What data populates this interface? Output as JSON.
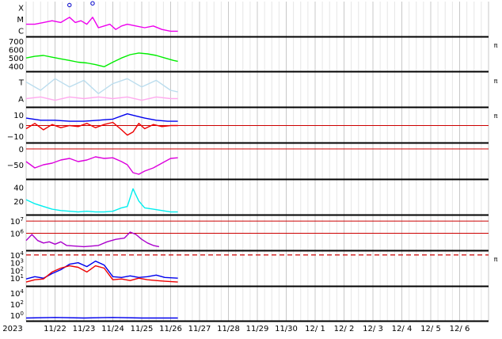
{
  "chart_data": {
    "type": "multi-panel-timeseries",
    "x_tick_labels": [
      "2023",
      "11/22",
      "11/23",
      "11/24",
      "11/25",
      "11/26",
      "11/27",
      "11/28",
      "11/29",
      "11/30",
      "12/ 1",
      "12/ 2",
      "12/ 3",
      "12/ 4",
      "12/ 5",
      "12/ 6"
    ],
    "x_start_day": 21.5,
    "x_end_day": 37.5,
    "data_end_day": 26.75,
    "panels": [
      {
        "id": "xray",
        "y_tick_labels": [
          "X",
          "M",
          "C"
        ],
        "right_label": "",
        "series": [
          {
            "color": "#ee00ee",
            "x": [
              21.5,
              21.8,
              22.1,
              22.4,
              22.7,
              23.0,
              23.2,
              23.4,
              23.6,
              23.8,
              24.0,
              24.2,
              24.4,
              24.6,
              24.8,
              25.0,
              25.3,
              25.6,
              25.9,
              26.2,
              26.5,
              26.75
            ],
            "y": [
              0.35,
              0.35,
              0.4,
              0.45,
              0.4,
              0.55,
              0.4,
              0.45,
              0.35,
              0.55,
              0.25,
              0.3,
              0.35,
              0.2,
              0.3,
              0.35,
              0.3,
              0.25,
              0.3,
              0.2,
              0.15,
              0.15
            ]
          }
        ],
        "markers": [
          {
            "x": 23.0,
            "y": 0.9
          },
          {
            "x": 23.8,
            "y": 0.95
          }
        ]
      },
      {
        "id": "solar-wind-speed",
        "y_tick_labels": [
          "700",
          "600",
          "500",
          "400"
        ],
        "y_tick_values": [
          700,
          600,
          500,
          400
        ],
        "ylim": [
          340,
          740
        ],
        "right_label": "π",
        "series": [
          {
            "color": "#00ee00",
            "x": [
              21.5,
              21.8,
              22.1,
              22.4,
              22.7,
              23.0,
              23.3,
              23.6,
              23.9,
              24.2,
              24.5,
              24.8,
              25.1,
              25.4,
              25.7,
              26.0,
              26.3,
              26.6,
              26.75
            ],
            "y": [
              500,
              520,
              530,
              510,
              490,
              470,
              450,
              440,
              420,
              395,
              450,
              500,
              540,
              560,
              550,
              530,
              500,
              470,
              460
            ]
          }
        ]
      },
      {
        "id": "imf-direction",
        "y_tick_labels": [
          "T",
          "A"
        ],
        "right_label": "π",
        "series": [
          {
            "color": "#bbddee",
            "x": [
              21.5,
              22.0,
              22.5,
              23.0,
              23.5,
              24.0,
              24.5,
              25.0,
              25.5,
              26.0,
              26.5,
              26.75
            ],
            "y": [
              0.75,
              0.5,
              0.85,
              0.6,
              0.8,
              0.4,
              0.7,
              0.85,
              0.6,
              0.8,
              0.5,
              0.45
            ]
          },
          {
            "color": "#ffaaee",
            "x": [
              21.5,
              22.0,
              22.5,
              23.0,
              23.5,
              24.0,
              24.5,
              25.0,
              25.5,
              26.0,
              26.5,
              26.75
            ],
            "y": [
              0.25,
              0.3,
              0.2,
              0.3,
              0.25,
              0.3,
              0.25,
              0.3,
              0.2,
              0.3,
              0.25,
              0.25
            ]
          }
        ]
      },
      {
        "id": "imf-magnitude",
        "y_tick_labels": [
          "10",
          "0",
          "−10"
        ],
        "y_tick_values": [
          10,
          0,
          -10
        ],
        "ylim": [
          -16,
          16
        ],
        "reference_lines": [
          0
        ],
        "right_label": "π",
        "series": [
          {
            "color": "#0000ee",
            "x": [
              21.5,
              22.0,
              22.5,
              23.0,
              23.5,
              24.0,
              24.5,
              25.0,
              25.3,
              25.6,
              26.0,
              26.4,
              26.75
            ],
            "y": [
              7,
              5,
              5,
              4,
              4,
              5,
              6,
              11,
              9,
              7,
              5,
              4,
              4
            ]
          },
          {
            "color": "#ee0000",
            "x": [
              21.5,
              21.8,
              22.1,
              22.4,
              22.7,
              23.0,
              23.3,
              23.6,
              23.9,
              24.2,
              24.5,
              24.8,
              25.0,
              25.2,
              25.4,
              25.6,
              25.9,
              26.2,
              26.5,
              26.75
            ],
            "y": [
              -3,
              2,
              -4,
              1,
              -2,
              0,
              -1,
              2,
              -2,
              1,
              3,
              -4,
              -9,
              -6,
              2,
              -3,
              1,
              -1,
              0,
              0
            ]
          }
        ]
      },
      {
        "id": "dst",
        "y_tick_labels": [
          "0",
          "−50"
        ],
        "y_tick_values": [
          0,
          -50
        ],
        "ylim": [
          -95,
          15
        ],
        "reference_lines": [
          0
        ],
        "right_label": "",
        "series": [
          {
            "color": "#dd00dd",
            "x": [
              21.5,
              21.8,
              22.1,
              22.4,
              22.7,
              23.0,
              23.3,
              23.6,
              23.9,
              24.2,
              24.5,
              24.8,
              25.0,
              25.2,
              25.4,
              25.6,
              25.9,
              26.2,
              26.5,
              26.75
            ],
            "y": [
              -40,
              -60,
              -50,
              -45,
              -35,
              -30,
              -40,
              -35,
              -25,
              -30,
              -28,
              -40,
              -50,
              -75,
              -80,
              -70,
              -60,
              -45,
              -30,
              -28
            ]
          }
        ]
      },
      {
        "id": "density",
        "y_tick_labels": [
          "40",
          "20"
        ],
        "y_tick_values": [
          40,
          20
        ],
        "ylim": [
          0,
          50
        ],
        "right_label": "",
        "series": [
          {
            "color": "#00eeee",
            "x": [
              21.5,
              21.8,
              22.1,
              22.4,
              22.7,
              23.0,
              23.3,
              23.6,
              23.9,
              24.2,
              24.5,
              24.8,
              25.0,
              25.2,
              25.4,
              25.6,
              25.9,
              26.2,
              26.5,
              26.75
            ],
            "y": [
              22,
              16,
              12,
              8,
              6,
              5,
              4,
              5,
              4,
              4,
              5,
              10,
              12,
              38,
              20,
              10,
              8,
              6,
              4,
              4
            ]
          }
        ]
      },
      {
        "id": "electron-flux",
        "y_tick_labels": [
          "10^7",
          "10^6"
        ],
        "y_tick_values": [
          7,
          6
        ],
        "ylim": [
          4.6,
          7.4
        ],
        "reference_lines": [
          7,
          6
        ],
        "right_label": "",
        "series": [
          {
            "color": "#aa00cc",
            "x": [
              21.5,
              21.7,
              21.9,
              22.1,
              22.3,
              22.5,
              22.7,
              22.9,
              23.5,
              24.0,
              24.3,
              24.6,
              24.9,
              25.1,
              25.3,
              25.5,
              25.7,
              25.9,
              26.1
            ],
            "y": [
              5.4,
              5.9,
              5.4,
              5.2,
              5.3,
              5.1,
              5.3,
              5.0,
              4.9,
              5.0,
              5.3,
              5.5,
              5.6,
              6.1,
              5.9,
              5.5,
              5.2,
              5.0,
              4.9
            ]
          }
        ]
      },
      {
        "id": "proton-flux",
        "y_tick_labels": [
          "10^4",
          "10^3",
          "10^2",
          "10^1"
        ],
        "y_tick_values": [
          4,
          3,
          2,
          1
        ],
        "ylim": [
          0,
          4.4
        ],
        "dashed_lines": [
          4
        ],
        "right_label": "π",
        "series": [
          {
            "color": "#0000ee",
            "x": [
              21.5,
              21.8,
              22.1,
              22.4,
              22.7,
              23.0,
              23.3,
              23.6,
              23.9,
              24.2,
              24.5,
              24.8,
              25.1,
              25.4,
              25.7,
              26.0,
              26.3,
              26.75
            ],
            "y": [
              0.9,
              1.2,
              1.0,
              1.6,
              2.1,
              2.8,
              3.0,
              2.5,
              3.2,
              2.7,
              1.2,
              1.1,
              1.3,
              1.1,
              1.2,
              1.4,
              1.1,
              1.0
            ]
          },
          {
            "color": "#ee0000",
            "x": [
              21.5,
              21.8,
              22.1,
              22.4,
              22.7,
              23.0,
              23.3,
              23.6,
              23.9,
              24.2,
              24.5,
              24.8,
              25.1,
              25.4,
              25.7,
              26.0,
              26.3,
              26.75
            ],
            "y": [
              0.5,
              0.8,
              0.9,
              1.8,
              2.3,
              2.6,
              2.4,
              1.8,
              2.6,
              2.3,
              0.8,
              0.9,
              0.7,
              1.0,
              0.8,
              0.7,
              0.6,
              0.5
            ]
          }
        ]
      },
      {
        "id": "extra-flux",
        "y_tick_labels": [
          "10^4",
          "10^2",
          "10^0"
        ],
        "y_tick_values": [
          4,
          2,
          0
        ],
        "ylim": [
          -1,
          5
        ],
        "right_label": "",
        "series": [
          {
            "color": "#0000ee",
            "x": [
              21.5,
              22.5,
              23.5,
              24.5,
              25.5,
              26.75
            ],
            "y": [
              -0.5,
              -0.4,
              -0.5,
              -0.4,
              -0.5,
              -0.5
            ]
          }
        ]
      }
    ]
  }
}
